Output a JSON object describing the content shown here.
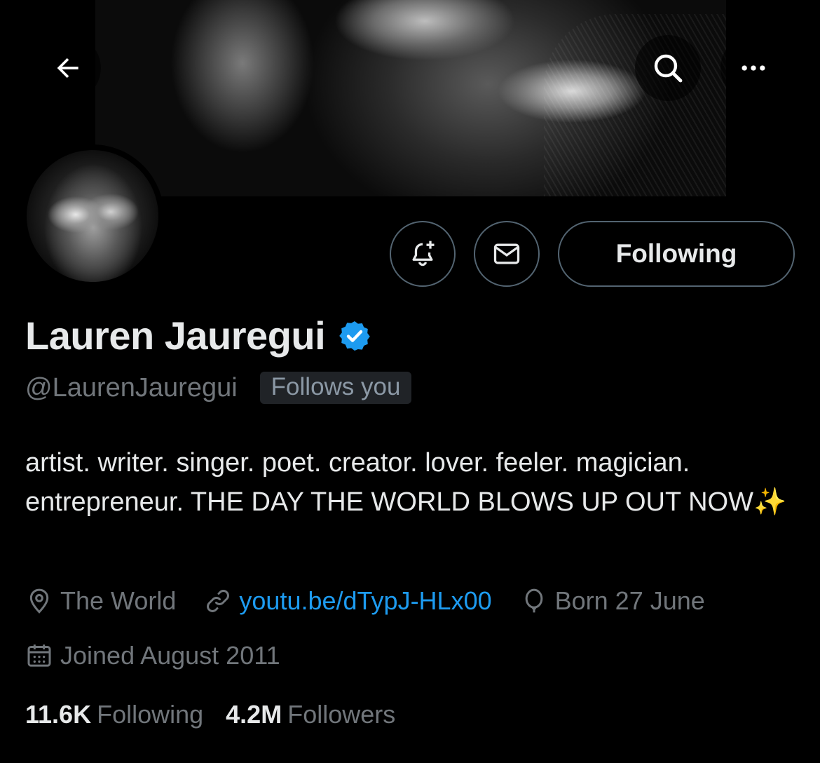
{
  "header": {
    "back_icon": "arrow-left-icon",
    "search_icon": "search-icon",
    "more_icon": "ellipsis-icon"
  },
  "actions": {
    "notify_icon": "bell-plus-icon",
    "message_icon": "envelope-icon",
    "following_label": "Following"
  },
  "profile": {
    "display_name": "Lauren Jauregui",
    "verified": true,
    "handle": "@LaurenJauregui",
    "follows_you_badge": "Follows you",
    "bio": "artist. writer. singer. poet. creator. lover. feeler. magician. entrepreneur. THE DAY THE WORLD BLOWS UP OUT NOW✨",
    "location": "The World",
    "website": "youtu.be/dTypJ-HLx00",
    "birthday": "Born 27 June",
    "joined": "Joined August 2011"
  },
  "stats": {
    "following_count": "11.6K",
    "following_label": "Following",
    "followers_count": "4.2M",
    "followers_label": "Followers"
  },
  "colors": {
    "background": "#000000",
    "primary_text": "#e7e9ea",
    "secondary_text": "#71767b",
    "link": "#1d9bf0",
    "border": "#536471",
    "verified_badge": "#1d9bf0",
    "badge_bg": "#202327"
  }
}
